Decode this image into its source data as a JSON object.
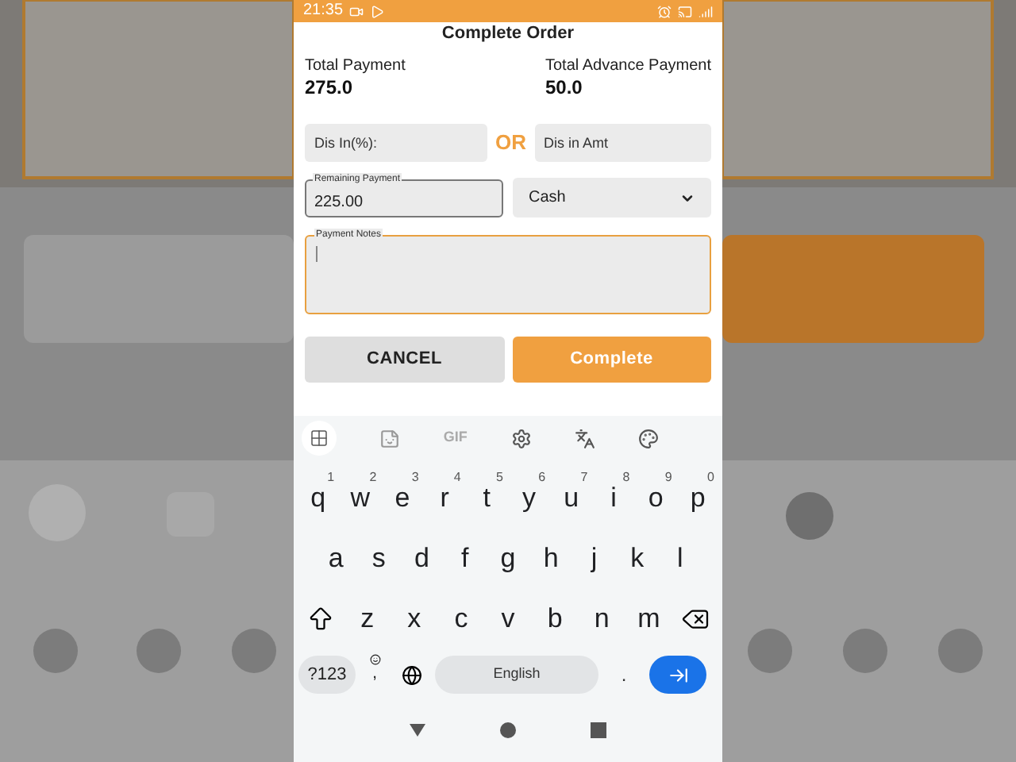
{
  "status_bar": {
    "time": "21:35"
  },
  "dialog": {
    "title": "Complete Order",
    "totals": [
      {
        "label": "Total Payment",
        "value": "275.0"
      },
      {
        "label": "Total Advance Payment",
        "value": "50.0"
      }
    ],
    "discount_percent": {
      "placeholder": "Dis In(%):"
    },
    "or_label": "OR",
    "discount_amount": {
      "placeholder": "Dis in Amt"
    },
    "remaining_payment": {
      "label": "Remaining Payment",
      "value": "225.00"
    },
    "payment_method": {
      "value": "Cash"
    },
    "notes": {
      "label": "Payment Notes",
      "focused": true
    },
    "buttons": [
      {
        "label": "CANCEL",
        "kind": "secondary"
      },
      {
        "label": "Complete",
        "kind": "primary"
      }
    ]
  },
  "keyboard": {
    "toolbar_label": "GIF",
    "rows": [
      [
        {
          "label": "q",
          "hint": "1"
        },
        {
          "label": "w",
          "hint": "2"
        },
        {
          "label": "e",
          "hint": "3"
        },
        {
          "label": "r",
          "hint": "4"
        },
        {
          "label": "t",
          "hint": "5"
        },
        {
          "label": "y",
          "hint": "6"
        },
        {
          "label": "u",
          "hint": "7"
        },
        {
          "label": "i",
          "hint": "8"
        },
        {
          "label": "o",
          "hint": "9"
        },
        {
          "label": "p",
          "hint": "0"
        }
      ],
      [
        {
          "label": "a"
        },
        {
          "label": "s"
        },
        {
          "label": "d"
        },
        {
          "label": "f"
        },
        {
          "label": "g"
        },
        {
          "label": "h"
        },
        {
          "label": "j"
        },
        {
          "label": "k"
        },
        {
          "label": "l"
        }
      ],
      [
        {
          "kind": "shift"
        },
        {
          "label": "z"
        },
        {
          "label": "x"
        },
        {
          "label": "c"
        },
        {
          "label": "v"
        },
        {
          "label": "b"
        },
        {
          "label": "n"
        },
        {
          "label": "m"
        },
        {
          "kind": "backspace"
        }
      ]
    ],
    "symbols_key": "?123",
    "comma_key": ",",
    "space_label": "English",
    "period_key": "."
  }
}
